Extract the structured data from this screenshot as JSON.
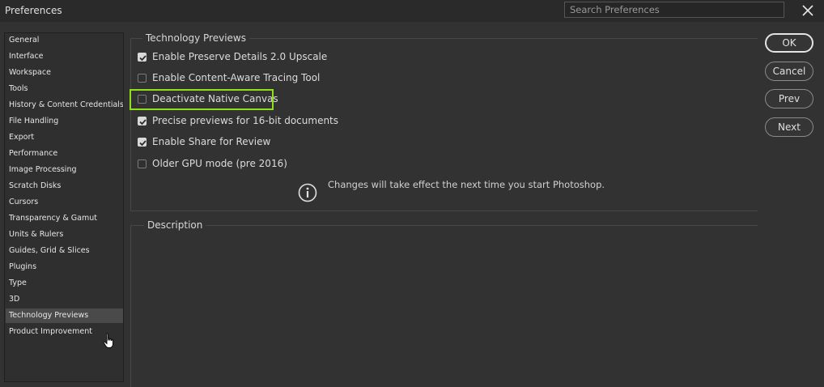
{
  "window": {
    "title": "Preferences",
    "search_placeholder": "Search Preferences"
  },
  "sidebar": {
    "items": [
      {
        "label": "General"
      },
      {
        "label": "Interface"
      },
      {
        "label": "Workspace"
      },
      {
        "label": "Tools"
      },
      {
        "label": "History & Content Credentials"
      },
      {
        "label": "File Handling"
      },
      {
        "label": "Export"
      },
      {
        "label": "Performance"
      },
      {
        "label": "Image Processing"
      },
      {
        "label": "Scratch Disks"
      },
      {
        "label": "Cursors"
      },
      {
        "label": "Transparency & Gamut"
      },
      {
        "label": "Units & Rulers"
      },
      {
        "label": "Guides, Grid & Slices"
      },
      {
        "label": "Plugins"
      },
      {
        "label": "Type"
      },
      {
        "label": "3D"
      },
      {
        "label": "Technology Previews",
        "selected": true
      },
      {
        "label": "Product Improvement"
      }
    ]
  },
  "tech_previews": {
    "title": "Technology Previews",
    "options": [
      {
        "label": "Enable Preserve Details 2.0 Upscale",
        "checked": true
      },
      {
        "label": "Enable Content-Aware Tracing Tool",
        "checked": false
      },
      {
        "label": "Deactivate Native Canvas",
        "checked": false,
        "highlighted": true
      },
      {
        "label": "Precise previews for 16-bit documents",
        "checked": true
      },
      {
        "label": "Enable Share for Review",
        "checked": true
      },
      {
        "label": "Older GPU mode (pre 2016)",
        "checked": false
      }
    ],
    "info_text": "Changes will take effect the next time you start Photoshop."
  },
  "description": {
    "title": "Description"
  },
  "buttons": {
    "ok": "OK",
    "cancel": "Cancel",
    "prev": "Prev",
    "next": "Next"
  },
  "colors": {
    "highlight": "#8ee01c",
    "background": "#323232"
  }
}
